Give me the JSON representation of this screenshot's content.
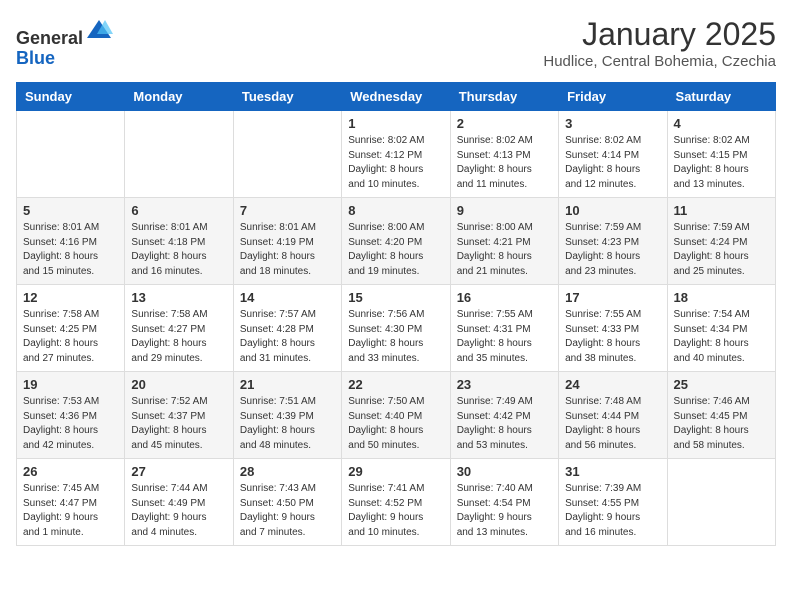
{
  "header": {
    "logo_line1": "General",
    "logo_line2": "Blue",
    "title": "January 2025",
    "subtitle": "Hudlice, Central Bohemia, Czechia"
  },
  "weekdays": [
    "Sunday",
    "Monday",
    "Tuesday",
    "Wednesday",
    "Thursday",
    "Friday",
    "Saturday"
  ],
  "weeks": [
    [
      {
        "day": "",
        "info": ""
      },
      {
        "day": "",
        "info": ""
      },
      {
        "day": "",
        "info": ""
      },
      {
        "day": "1",
        "info": "Sunrise: 8:02 AM\nSunset: 4:12 PM\nDaylight: 8 hours\nand 10 minutes."
      },
      {
        "day": "2",
        "info": "Sunrise: 8:02 AM\nSunset: 4:13 PM\nDaylight: 8 hours\nand 11 minutes."
      },
      {
        "day": "3",
        "info": "Sunrise: 8:02 AM\nSunset: 4:14 PM\nDaylight: 8 hours\nand 12 minutes."
      },
      {
        "day": "4",
        "info": "Sunrise: 8:02 AM\nSunset: 4:15 PM\nDaylight: 8 hours\nand 13 minutes."
      }
    ],
    [
      {
        "day": "5",
        "info": "Sunrise: 8:01 AM\nSunset: 4:16 PM\nDaylight: 8 hours\nand 15 minutes."
      },
      {
        "day": "6",
        "info": "Sunrise: 8:01 AM\nSunset: 4:18 PM\nDaylight: 8 hours\nand 16 minutes."
      },
      {
        "day": "7",
        "info": "Sunrise: 8:01 AM\nSunset: 4:19 PM\nDaylight: 8 hours\nand 18 minutes."
      },
      {
        "day": "8",
        "info": "Sunrise: 8:00 AM\nSunset: 4:20 PM\nDaylight: 8 hours\nand 19 minutes."
      },
      {
        "day": "9",
        "info": "Sunrise: 8:00 AM\nSunset: 4:21 PM\nDaylight: 8 hours\nand 21 minutes."
      },
      {
        "day": "10",
        "info": "Sunrise: 7:59 AM\nSunset: 4:23 PM\nDaylight: 8 hours\nand 23 minutes."
      },
      {
        "day": "11",
        "info": "Sunrise: 7:59 AM\nSunset: 4:24 PM\nDaylight: 8 hours\nand 25 minutes."
      }
    ],
    [
      {
        "day": "12",
        "info": "Sunrise: 7:58 AM\nSunset: 4:25 PM\nDaylight: 8 hours\nand 27 minutes."
      },
      {
        "day": "13",
        "info": "Sunrise: 7:58 AM\nSunset: 4:27 PM\nDaylight: 8 hours\nand 29 minutes."
      },
      {
        "day": "14",
        "info": "Sunrise: 7:57 AM\nSunset: 4:28 PM\nDaylight: 8 hours\nand 31 minutes."
      },
      {
        "day": "15",
        "info": "Sunrise: 7:56 AM\nSunset: 4:30 PM\nDaylight: 8 hours\nand 33 minutes."
      },
      {
        "day": "16",
        "info": "Sunrise: 7:55 AM\nSunset: 4:31 PM\nDaylight: 8 hours\nand 35 minutes."
      },
      {
        "day": "17",
        "info": "Sunrise: 7:55 AM\nSunset: 4:33 PM\nDaylight: 8 hours\nand 38 minutes."
      },
      {
        "day": "18",
        "info": "Sunrise: 7:54 AM\nSunset: 4:34 PM\nDaylight: 8 hours\nand 40 minutes."
      }
    ],
    [
      {
        "day": "19",
        "info": "Sunrise: 7:53 AM\nSunset: 4:36 PM\nDaylight: 8 hours\nand 42 minutes."
      },
      {
        "day": "20",
        "info": "Sunrise: 7:52 AM\nSunset: 4:37 PM\nDaylight: 8 hours\nand 45 minutes."
      },
      {
        "day": "21",
        "info": "Sunrise: 7:51 AM\nSunset: 4:39 PM\nDaylight: 8 hours\nand 48 minutes."
      },
      {
        "day": "22",
        "info": "Sunrise: 7:50 AM\nSunset: 4:40 PM\nDaylight: 8 hours\nand 50 minutes."
      },
      {
        "day": "23",
        "info": "Sunrise: 7:49 AM\nSunset: 4:42 PM\nDaylight: 8 hours\nand 53 minutes."
      },
      {
        "day": "24",
        "info": "Sunrise: 7:48 AM\nSunset: 4:44 PM\nDaylight: 8 hours\nand 56 minutes."
      },
      {
        "day": "25",
        "info": "Sunrise: 7:46 AM\nSunset: 4:45 PM\nDaylight: 8 hours\nand 58 minutes."
      }
    ],
    [
      {
        "day": "26",
        "info": "Sunrise: 7:45 AM\nSunset: 4:47 PM\nDaylight: 9 hours\nand 1 minute."
      },
      {
        "day": "27",
        "info": "Sunrise: 7:44 AM\nSunset: 4:49 PM\nDaylight: 9 hours\nand 4 minutes."
      },
      {
        "day": "28",
        "info": "Sunrise: 7:43 AM\nSunset: 4:50 PM\nDaylight: 9 hours\nand 7 minutes."
      },
      {
        "day": "29",
        "info": "Sunrise: 7:41 AM\nSunset: 4:52 PM\nDaylight: 9 hours\nand 10 minutes."
      },
      {
        "day": "30",
        "info": "Sunrise: 7:40 AM\nSunset: 4:54 PM\nDaylight: 9 hours\nand 13 minutes."
      },
      {
        "day": "31",
        "info": "Sunrise: 7:39 AM\nSunset: 4:55 PM\nDaylight: 9 hours\nand 16 minutes."
      },
      {
        "day": "",
        "info": ""
      }
    ]
  ]
}
